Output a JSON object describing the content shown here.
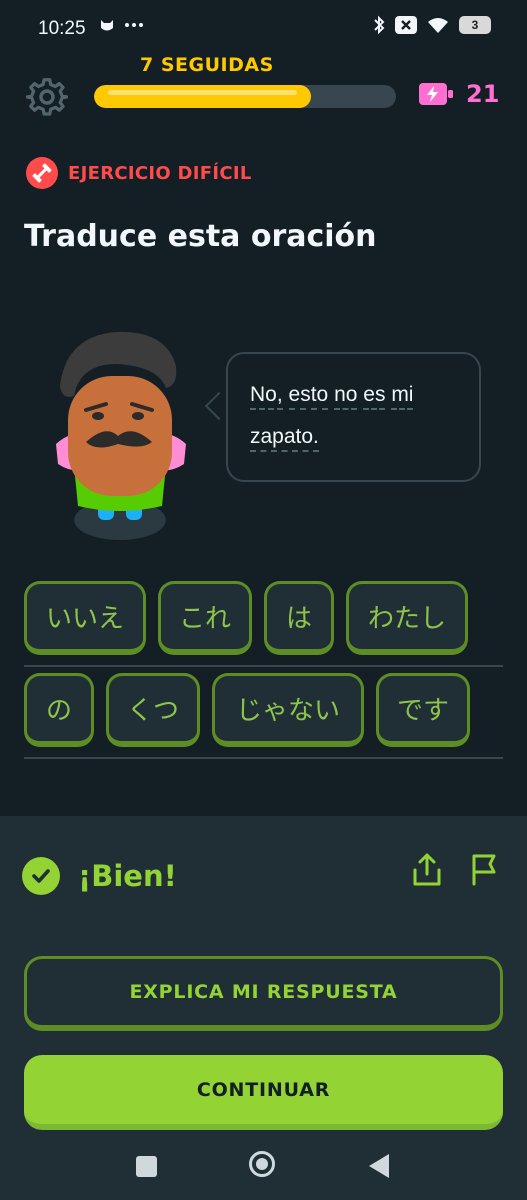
{
  "status_bar": {
    "time": "10:25",
    "battery": "3",
    "icons": [
      "cat-notification-icon",
      "more-dots-icon",
      "bluetooth-icon",
      "mute-icon",
      "wifi-icon",
      "battery-icon"
    ]
  },
  "lesson": {
    "streak_text": "7 SEGUIDAS",
    "progress": 0.72,
    "energy_count": "21",
    "colors": {
      "progress": "#ffc800",
      "energy": "#ff6fd1"
    }
  },
  "exercise": {
    "badge": "EJERCICIO DIFÍCIL",
    "badge_color": "#ff4b4b",
    "title": "Traduce esta oración",
    "sentence_lines": [
      [
        "No,",
        "esto",
        "no",
        "es",
        "mi"
      ],
      [
        "zapato."
      ]
    ]
  },
  "word_bank": {
    "row1": [
      "いいえ",
      "これ",
      "は",
      "わたし"
    ],
    "row2": [
      "の",
      "くつ",
      "じゃない",
      "です"
    ]
  },
  "result": {
    "text": "¡Bien!",
    "color": "#93d333",
    "explain_button": "EXPLICA MI RESPUESTA",
    "continue_button": "CONTINUAR"
  }
}
